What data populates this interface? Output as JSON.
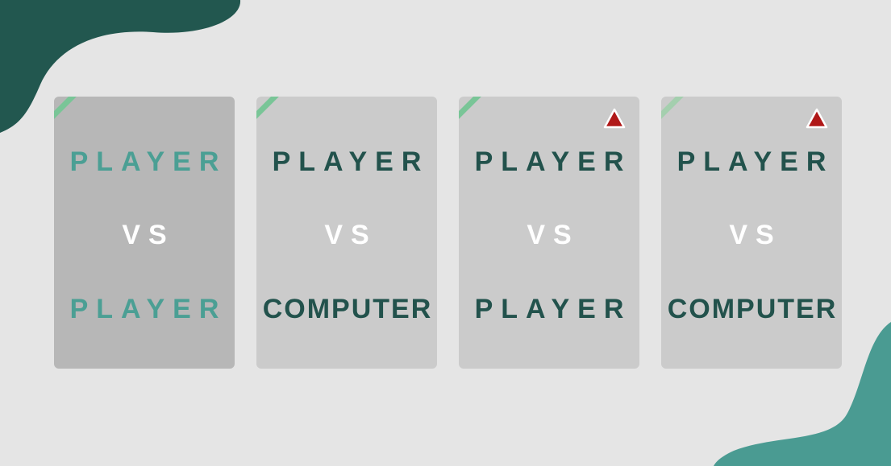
{
  "modes": [
    {
      "top": "PLAYER",
      "mid": "VS",
      "bottom": "PLAYER",
      "selected": true,
      "warning": false
    },
    {
      "top": "PLAYER",
      "mid": "VS",
      "bottom": "COMPUTER",
      "selected": false,
      "warning": false
    },
    {
      "top": "PLAYER",
      "mid": "VS",
      "bottom": "PLAYER",
      "selected": false,
      "warning": true
    },
    {
      "top": "PLAYER",
      "mid": "VS",
      "bottom": "COMPUTER",
      "selected": false,
      "warning": true
    }
  ],
  "icons": {
    "corner_stripe": "accent-stripe",
    "warning": "warning-triangle-icon"
  },
  "colors": {
    "background": "#e5e5e5",
    "card": "#cbcbcb",
    "card_selected": "#b7b7b7",
    "text_dark": "#22524c",
    "text_teal": "#4b9f94",
    "stripe": "#79c597",
    "warning": "#b01818",
    "blob_dark": "#22574f",
    "blob_teal": "#4a9b92"
  }
}
